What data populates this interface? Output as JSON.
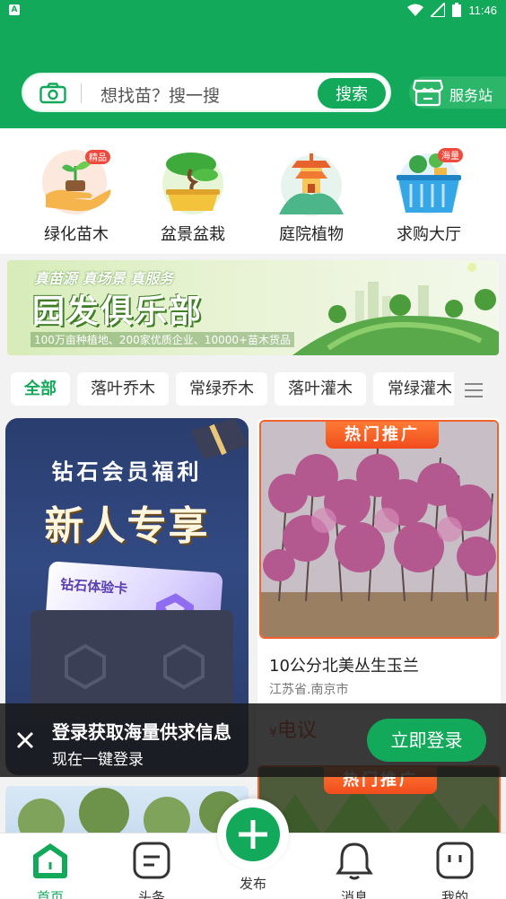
{
  "status_bar": {
    "notification_badge": "A",
    "time": "11:46"
  },
  "search": {
    "placeholder": "想找苗？搜一搜",
    "button_label": "搜索",
    "service_label": "服务站"
  },
  "categories": [
    {
      "label": "绿化苗木",
      "badge": "精品",
      "icon": "seedling-hand-icon"
    },
    {
      "label": "盆景盆栽",
      "icon": "bonsai-icon"
    },
    {
      "label": "庭院植物",
      "icon": "pavilion-icon"
    },
    {
      "label": "求购大厅",
      "badge": "海量",
      "icon": "shopping-basket-icon"
    }
  ],
  "banner": {
    "tagline": "真苗源 真场景 真服务",
    "title": "园发俱乐部",
    "subtitle": "100万亩种植地、200家优质企业、10000+苗木货品"
  },
  "filter_tabs": [
    "全部",
    "落叶乔木",
    "常绿乔木",
    "落叶灌木",
    "常绿灌木"
  ],
  "promo": {
    "line1": "钻石会员福利",
    "line2": "新人专享",
    "card_label": "钻石体验卡"
  },
  "product": {
    "tag": "热门推广",
    "name": "10公分北美丛生玉兰",
    "location": "江苏省.南京市",
    "price_symbol": "¥",
    "price": "电议"
  },
  "product2": {
    "tag": "热门推广"
  },
  "login_prompt": {
    "title": "登录获取海量供求信息",
    "subtitle": "现在一键登录",
    "button_label": "立即登录"
  },
  "bottom_nav": {
    "home": "首页",
    "headlines": "头条",
    "publish": "发布",
    "messages": "消息",
    "mine": "我的"
  },
  "colors": {
    "brand_green": "#13a95a",
    "hot_orange": "#f04c1c",
    "price_red": "#e8442a"
  }
}
